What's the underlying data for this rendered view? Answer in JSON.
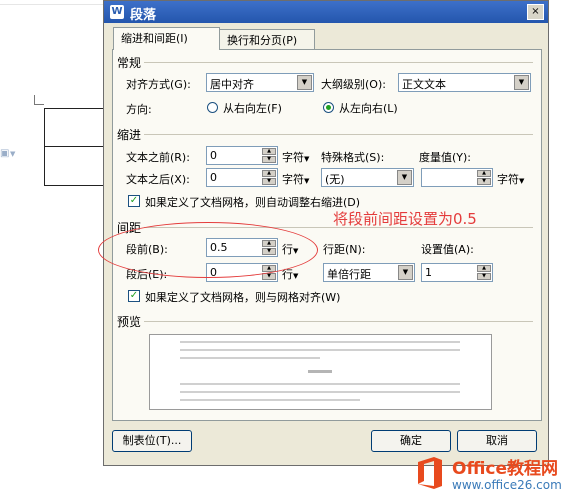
{
  "dialog": {
    "title": "段落",
    "app_icon": "W",
    "close_symbol": "×",
    "tabs": [
      {
        "label": "缩进和间距(I)"
      },
      {
        "label": "换行和分页(P)"
      }
    ]
  },
  "general": {
    "header": "常规",
    "alignment_label": "对齐方式(G):",
    "alignment_value": "居中对齐",
    "outline_label": "大纲级别(O):",
    "outline_value": "正文文本",
    "direction_label": "方向:",
    "rtl_label": "从右向左(F)",
    "ltr_label": "从左向右(L)",
    "direction_selected": "ltr"
  },
  "indent": {
    "header": "缩进",
    "before_label": "文本之前(R):",
    "before_value": "0",
    "before_unit": "字符",
    "after_label": "文本之后(X):",
    "after_value": "0",
    "after_unit": "字符",
    "special_label": "特殊格式(S):",
    "special_value": "(无)",
    "measure_label": "度量值(Y):",
    "measure_value": "",
    "measure_unit": "字符",
    "auto_adjust_label": "如果定义了文档网格，则自动调整右缩进(D)",
    "auto_adjust_checked": true
  },
  "spacing": {
    "header": "间距",
    "before_label": "段前(B):",
    "before_value": "0.5",
    "before_unit": "行",
    "after_label": "段后(E):",
    "after_value": "0",
    "after_unit": "行",
    "line_spacing_label": "行距(N):",
    "line_spacing_value": "单倍行距",
    "setting_label": "设置值(A):",
    "setting_value": "1",
    "snap_grid_label": "如果定义了文档网格，则与网格对齐(W)",
    "snap_grid_checked": true
  },
  "preview": {
    "header": "预览",
    "sample_text": "示例文字"
  },
  "buttons": {
    "tabs": "制表位(T)...",
    "ok": "确定",
    "cancel": "取消"
  },
  "annotation": {
    "text": "将段前间距设置为0.5",
    "color": "#e43c3c"
  },
  "watermark": {
    "line1": "Office教程网",
    "line2": "www.office26.com"
  },
  "colors": {
    "title_bar": "#2a5db0",
    "dialog_bg": "#ece9d8",
    "checkbox_mark": "#21a121"
  },
  "icons": {
    "dropdown": "triangle-down",
    "spin_up": "triangle-up",
    "spin_down": "triangle-down"
  }
}
